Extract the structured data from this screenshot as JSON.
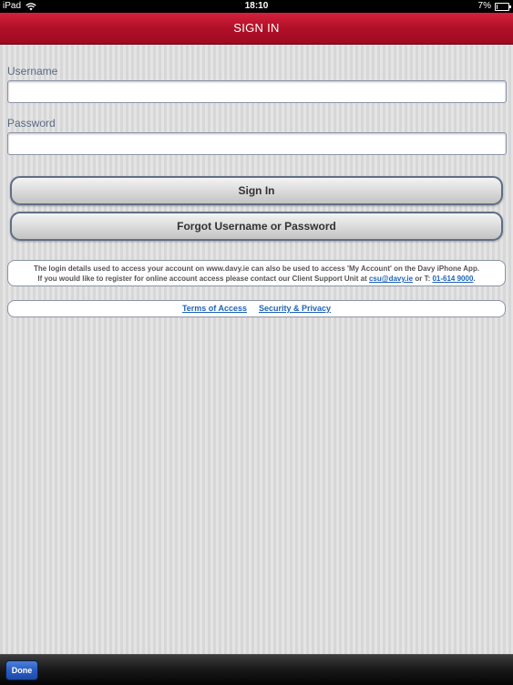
{
  "status_bar": {
    "device": "iPad",
    "time": "18:10",
    "battery": "7%"
  },
  "nav_bar": {
    "title": "SIGN IN"
  },
  "form": {
    "username_label": "Username",
    "username_value": "",
    "password_label": "Password",
    "password_value": "",
    "sign_in_label": "Sign In",
    "forgot_label": "Forgot Username or Password"
  },
  "info": {
    "line1": "The login details used to access your account on www.davy.ie can also be used to access 'My Account' on the Davy iPhone App.",
    "line2_prefix": "If you would like to register for online account access please contact our Client Support Unit at",
    "email": "csu@davy.ie",
    "line2_mid": "or T:",
    "phone": "01-614 9000",
    "line2_suffix": "."
  },
  "links": {
    "terms": "Terms of Access",
    "security": "Security & Privacy"
  },
  "toolbar": {
    "done_label": "Done"
  },
  "colors": {
    "nav_red": "#b01028",
    "link_blue": "#1f63b8",
    "done_blue": "#2a5cc2"
  }
}
